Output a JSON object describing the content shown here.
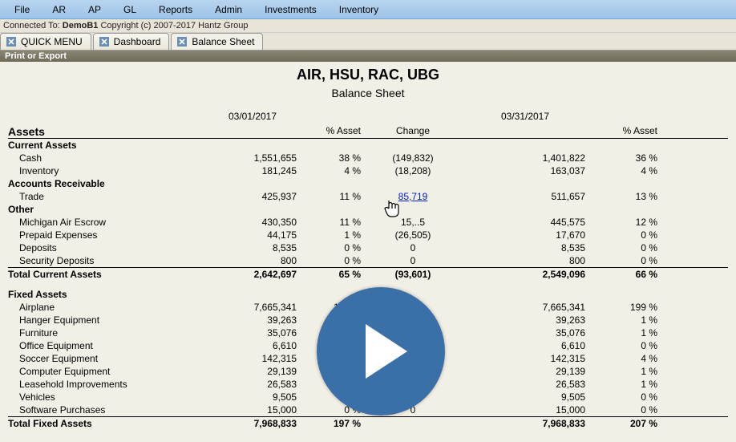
{
  "menu": [
    "File",
    "AR",
    "AP",
    "GL",
    "Reports",
    "Admin",
    "Investments",
    "Inventory"
  ],
  "status": {
    "left": "Connected To: ",
    "db": "DemoB1",
    "right": " Copyright (c) 2007-2017 Hantz Group"
  },
  "tabs": [
    {
      "label": "QUICK MENU",
      "active": false
    },
    {
      "label": "Dashboard",
      "active": false
    },
    {
      "label": "Balance Sheet",
      "active": true
    }
  ],
  "subbar": "Print or Export",
  "report": {
    "title": "AIR, HSU, RAC, UBG",
    "subtitle": "Balance Sheet",
    "date1": "03/01/2017",
    "date2": "03/31/2017",
    "col2h": "% Asset",
    "col3h": "Change",
    "col5h": "% Asset"
  },
  "assets_label": "Assets",
  "ca_label": "Current Assets",
  "ca_rows": [
    {
      "l": "Cash",
      "v1": "1,551,655",
      "p1": "38 %",
      "c": "(149,832)",
      "v2": "1,401,822",
      "p2": "36 %"
    },
    {
      "l": "Inventory",
      "v1": "181,245",
      "p1": "4 %",
      "c": "(18,208)",
      "v2": "163,037",
      "p2": "4 %"
    }
  ],
  "ar_label": "Accounts Receivable",
  "ar_rows": [
    {
      "l": "Trade",
      "v1": "425,937",
      "p1": "11 %",
      "c": "85,719",
      "v2": "511,657",
      "p2": "13 %",
      "link": true
    }
  ],
  "other_label": "Other",
  "other_rows": [
    {
      "l": "Michigan Air Escrow",
      "v1": "430,350",
      "p1": "11 %",
      "c": "15,..5",
      "v2": "445,575",
      "p2": "12 %"
    },
    {
      "l": "Prepaid Expenses",
      "v1": "44,175",
      "p1": "1 %",
      "c": "(26,505)",
      "v2": "17,670",
      "p2": "0 %"
    },
    {
      "l": "Deposits",
      "v1": "8,535",
      "p1": "0 %",
      "c": "0",
      "v2": "8,535",
      "p2": "0 %"
    },
    {
      "l": "Security Deposits",
      "v1": "800",
      "p1": "0 %",
      "c": "0",
      "v2": "800",
      "p2": "0 %"
    }
  ],
  "tca": {
    "l": "Total Current Assets",
    "v1": "2,642,697",
    "p1": "65 %",
    "c": "(93,601)",
    "v2": "2,549,096",
    "p2": "66 %"
  },
  "fa_label": "Fixed Assets",
  "fa_rows": [
    {
      "l": "Airplane",
      "v1": "7,665,341",
      "p1": "189 %",
      "c": "",
      "v2": "7,665,341",
      "p2": "199 %"
    },
    {
      "l": "Hanger Equipment",
      "v1": "39,263",
      "p1": "1",
      "c": "",
      "v2": "39,263",
      "p2": "1 %"
    },
    {
      "l": "Furniture",
      "v1": "35,076",
      "p1": "",
      "c": "",
      "v2": "35,076",
      "p2": "1 %"
    },
    {
      "l": "Office Equipment",
      "v1": "6,610",
      "p1": "",
      "c": "",
      "v2": "6,610",
      "p2": "0 %"
    },
    {
      "l": "Soccer Equipment",
      "v1": "142,315",
      "p1": "",
      "c": "",
      "v2": "142,315",
      "p2": "4 %"
    },
    {
      "l": "Computer Equipment",
      "v1": "29,139",
      "p1": "1",
      "c": "",
      "v2": "29,139",
      "p2": "1 %"
    },
    {
      "l": "Leasehold Improvements",
      "v1": "26,583",
      "p1": "1 %",
      "c": "",
      "v2": "26,583",
      "p2": "1 %"
    },
    {
      "l": "Vehicles",
      "v1": "9,505",
      "p1": "0 %",
      "c": "0",
      "v2": "9,505",
      "p2": "0 %"
    },
    {
      "l": "Software Purchases",
      "v1": "15,000",
      "p1": "0 %",
      "c": "0",
      "v2": "15,000",
      "p2": "0 %"
    }
  ],
  "tfa": {
    "l": "Total Fixed Assets",
    "v1": "7,968,833",
    "p1": "197 %",
    "c": "",
    "v2": "7,968,833",
    "p2": "207 %"
  }
}
